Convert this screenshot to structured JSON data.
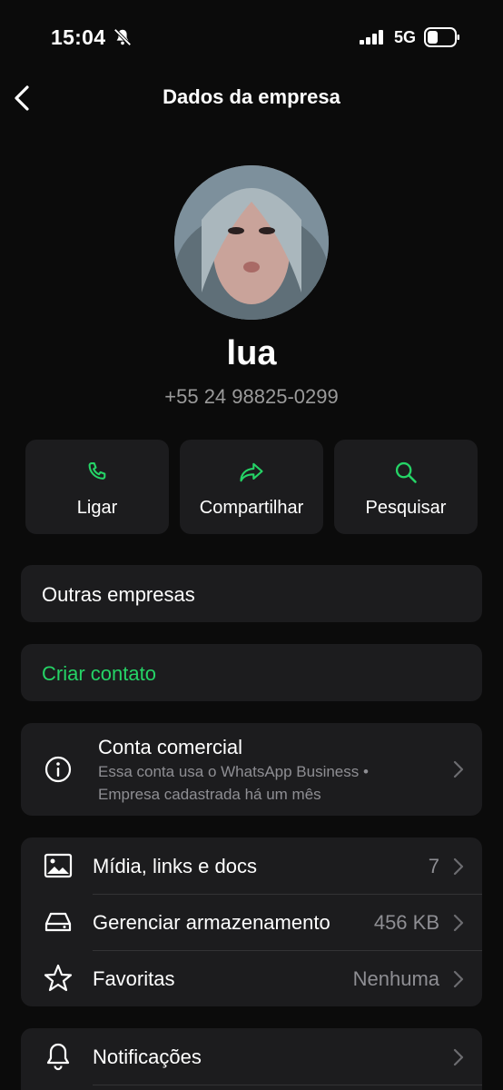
{
  "status": {
    "time": "15:04",
    "network": "5G"
  },
  "nav": {
    "title": "Dados da empresa"
  },
  "profile": {
    "name": "lua",
    "phone": "+55 24 98825-0299"
  },
  "actions": [
    {
      "label": "Ligar",
      "icon": "phone-icon"
    },
    {
      "label": "Compartilhar",
      "icon": "share-icon"
    },
    {
      "label": "Pesquisar",
      "icon": "search-icon"
    }
  ],
  "other_businesses": {
    "label": "Outras empresas"
  },
  "create_contact": {
    "label": "Criar contato"
  },
  "business_account": {
    "title": "Conta comercial",
    "line1": "Essa conta usa o WhatsApp Business •",
    "line2": "Empresa cadastrada há um mês"
  },
  "media_group": [
    {
      "label": "Mídia, links e docs",
      "value": "7",
      "icon": "image-icon"
    },
    {
      "label": "Gerenciar armazenamento",
      "value": "456 KB",
      "icon": "storage-icon"
    },
    {
      "label": "Favoritas",
      "value": "Nenhuma",
      "icon": "star-icon"
    }
  ],
  "notifications": {
    "label": "Notificações",
    "icon": "bell-icon"
  },
  "colors": {
    "accent": "#25d366",
    "card": "#1c1c1e",
    "background": "#0b0b0b",
    "muted": "#8e8e93"
  }
}
